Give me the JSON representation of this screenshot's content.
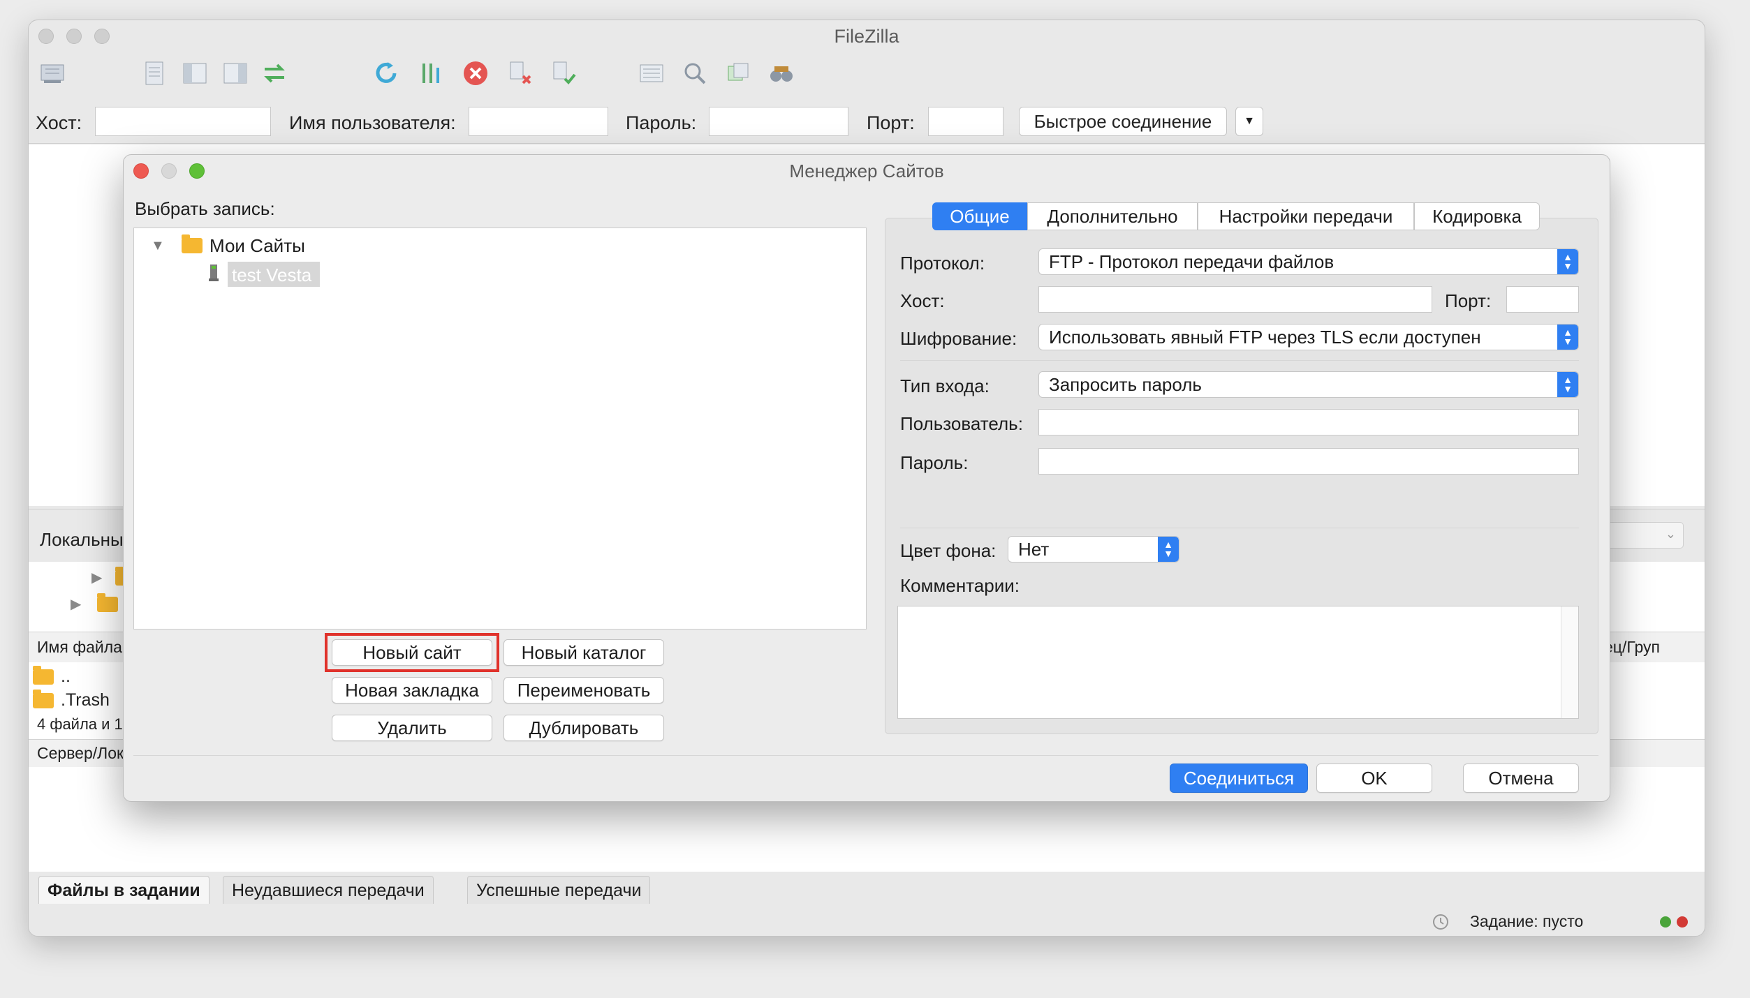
{
  "app": {
    "title": "FileZilla"
  },
  "quickconnect": {
    "host_label": "Хост:",
    "user_label": "Имя пользователя:",
    "pass_label": "Пароль:",
    "port_label": "Порт:",
    "connect_button": "Быстрое соединение"
  },
  "background": {
    "local_label": "Локальны",
    "filename_header": "Имя файла",
    "owner_header": "ец/Груп",
    "parent_entry": "..",
    "trash_entry": ".Trash",
    "files_count": "4 файла и 1",
    "server_header": "Сервер/Лок"
  },
  "queue_tabs": [
    "Файлы в задании",
    "Неудавшиеся передачи",
    "Успешные передачи"
  ],
  "status": {
    "queue": "Задание: пусто"
  },
  "site_manager": {
    "title": "Менеджер Сайтов",
    "select_entry_label": "Выбрать запись:",
    "tree": {
      "root": "Мои Сайты",
      "child": "test Vesta"
    },
    "buttons": {
      "new_site": "Новый сайт",
      "new_folder": "Новый каталог",
      "new_bookmark": "Новая закладка",
      "rename": "Переименовать",
      "delete": "Удалить",
      "duplicate": "Дублировать"
    },
    "tabs": [
      "Общие",
      "Дополнительно",
      "Настройки передачи",
      "Кодировка"
    ],
    "active_tab": "Общие",
    "form": {
      "protocol_label": "Протокол:",
      "protocol_value": "FTP - Протокол передачи файлов",
      "host_label": "Хост:",
      "host_value": "",
      "port_label": "Порт:",
      "port_value": "",
      "encryption_label": "Шифрование:",
      "encryption_value": "Использовать явный FTP через TLS если доступен",
      "logon_label": "Тип входа:",
      "logon_value": "Запросить пароль",
      "user_label": "Пользователь:",
      "user_value": "",
      "password_label": "Пароль:",
      "password_value": "",
      "bgcolor_label": "Цвет фона:",
      "bgcolor_value": "Нет",
      "comments_label": "Комментарии:",
      "comments_value": ""
    },
    "footer": {
      "connect": "Соединиться",
      "ok": "OK",
      "cancel": "Отмена"
    }
  },
  "colors": {
    "accent": "#2f7ff2",
    "highlight_box": "#e0322b",
    "close_light": "#ee5a52",
    "zoom_light": "#5fc038"
  }
}
